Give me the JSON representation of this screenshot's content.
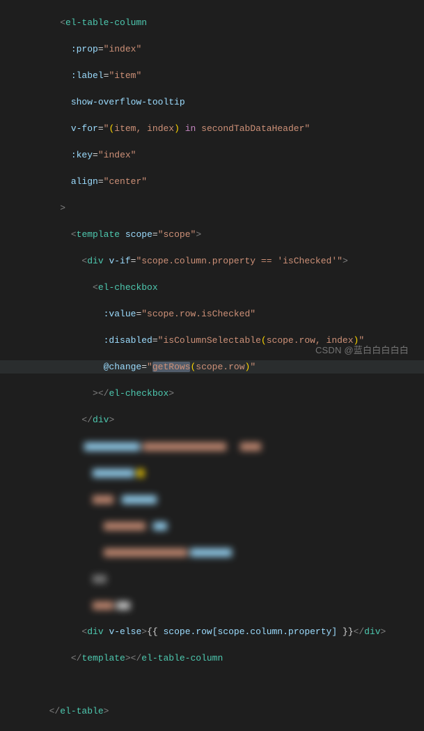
{
  "code": {
    "l1_open": "<",
    "l1_tag": "el-table-column",
    "l2_attr": ":prop",
    "l2_eq": "=",
    "l2_val": "\"index\"",
    "l3_attr": ":label",
    "l3_val": "\"item\"",
    "l4_attr": "show-overflow-tooltip",
    "l5_attr": "v-for",
    "l5_val_open": "\"",
    "l5_paren_open": "(",
    "l5_item": "item, index",
    "l5_paren_close": ")",
    "l5_in": " in ",
    "l5_var": "secondTabDataHeader",
    "l5_val_close": "\"",
    "l6_attr": ":key",
    "l6_val": "\"index\"",
    "l7_attr": "align",
    "l7_val": "\"center\"",
    "l8_close": ">",
    "l9_tag": "template",
    "l9_attr": "scope",
    "l9_val": "\"scope\"",
    "l10_tag": "div",
    "l10_attr": "v-if",
    "l10_val": "\"scope.column.property == 'isChecked'\"",
    "l11_tag": "el-checkbox",
    "l12_attr": ":value",
    "l12_val": "\"scope.row.isChecked\"",
    "l13_attr": ":disabled",
    "l13_val_open": "\"",
    "l13_func": "isColumnSelectable",
    "l13_paren_open": "(",
    "l13_args": "scope.row, index",
    "l13_paren_close": ")",
    "l13_val_close": "\"",
    "l14_attr": "@change",
    "l14_val_open": "\"",
    "l14_func": "getRows",
    "l14_paren_open": "(",
    "l14_args": "scope.row",
    "l14_paren_close": ")",
    "l14_val_close": "\"",
    "l15_close_open": "></",
    "l15_tag": "el-checkbox",
    "l15_close": ">",
    "l16_close_open": "</",
    "l16_tag": "div",
    "l16_close": ">",
    "l24_tag": "div",
    "l24_attr": "v-else",
    "l24_close": ">",
    "l24_expr_open": "{{ ",
    "l24_expr": "scope.row[scope.column.property]",
    "l24_expr_close": " }}",
    "l24_end_open": "</",
    "l24_end_close": ">",
    "l25_close_open": "</",
    "l25_tag1": "template",
    "l25_mid": "></",
    "l25_tag2": "el-table-column",
    "l27_close_open": "</",
    "l27_tag": "el-table",
    "l27_close": ">"
  },
  "watermark": "CSDN @蓝白白白白白"
}
